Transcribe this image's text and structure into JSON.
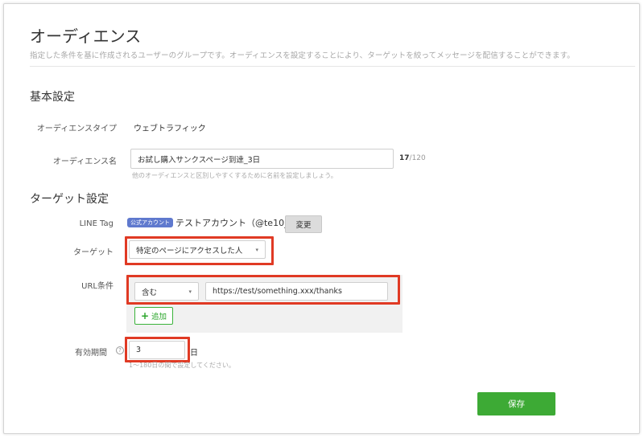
{
  "page": {
    "title": "オーディエンス",
    "description": "指定した条件を基に作成されるユーザーのグループです。オーディエンスを設定することにより、ターゲットを絞ってメッセージを配信することができます。"
  },
  "basic": {
    "section_title": "基本設定",
    "type_label": "オーディエンスタイプ",
    "type_value": "ウェブトラフィック",
    "name_label": "オーディエンス名",
    "name_value": "お試し購入サンクスページ到達_3日",
    "name_count": "17",
    "name_max": "/120",
    "name_hint": "他のオーディエンスと区別しやすくするために名前を設定しましょう。"
  },
  "target": {
    "section_title": "ターゲット設定",
    "linetag_label": "LINE Tag",
    "badge": "公式アカウント",
    "account": "テストアカウント（@te10_）",
    "change_button": "変更",
    "target_label": "ターゲット",
    "target_value": "特定のページにアクセスした人",
    "url_label": "URL条件",
    "url_condition": "含む",
    "url_value": "https://test/something.xxx/thanks",
    "add_button": "追加",
    "period_label": "有効期間",
    "period_value": "3",
    "period_unit": "日",
    "period_hint": "1〜180日の間で設定してください。"
  },
  "footer": {
    "save_button": "保存"
  },
  "colors": {
    "highlight": "#e03a24",
    "save": "#3daa35",
    "badge": "#5f79ce"
  },
  "icons": {
    "help": "help-circle-icon",
    "add": "plus-icon",
    "dropdown": "chevron-down-icon"
  }
}
